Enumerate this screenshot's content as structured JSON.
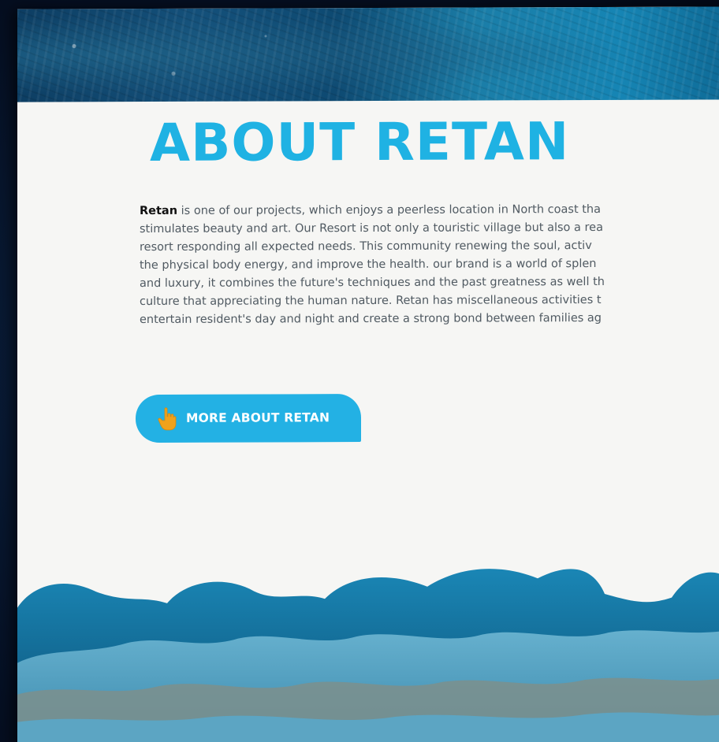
{
  "about": {
    "title": "ABOUT RETAN",
    "brand": "Retan",
    "paragraph_lines": [
      " is one of our projects, which enjoys a peerless location in North coast tha",
      "stimulates beauty and art. Our Resort  is not only a touristic village but also a rea",
      "resort responding all expected needs. This community renewing the soul, activ",
      "the physical body energy, and improve the health. our brand is a world of splen",
      "and luxury, it combines the future's techniques and the past greatness as well th",
      "culture that appreciating the human nature. Retan has miscellaneous activities t",
      "entertain resident's day and night and create a strong bond between families ag"
    ],
    "button_label": "MORE ABOUT RETAN",
    "button_icon": "hand-pointer-icon"
  },
  "colors": {
    "accent": "#23b1e4",
    "title": "#1fb2e3",
    "icon": "#f0a21c",
    "body_text": "#505a62",
    "page_background": "#f6f6f4"
  }
}
